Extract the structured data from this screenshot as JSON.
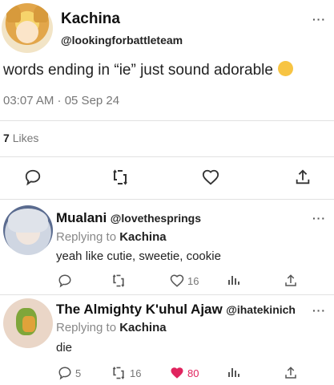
{
  "main_tweet": {
    "display_name": "Kachina",
    "handle": "@lookingforbattleteam",
    "text": "words ending in “ie” just sound adorable",
    "emoji": "relieved-face-emoji",
    "timestamp": "03:07 AM · 05 Sep 24",
    "likes_count": "7",
    "likes_label": "Likes"
  },
  "replies": [
    {
      "display_name": "Mualani",
      "handle": "@lovethesprings",
      "replying_label": "Replying to",
      "replying_to": "Kachina",
      "text": "yeah like cutie, sweetie, cookie",
      "reply_count": "",
      "retweet_count": "",
      "like_count": "16"
    },
    {
      "display_name": "The Almighty K'uhul Ajaw",
      "handle": "@ihatekinich",
      "replying_label": "Replying to",
      "replying_to": "Kachina",
      "text": "die",
      "reply_count": "5",
      "retweet_count": "16",
      "like_count": "80"
    }
  ],
  "more_label": "···",
  "colors": {
    "like_active": "#e0245e",
    "muted": "#777777"
  }
}
